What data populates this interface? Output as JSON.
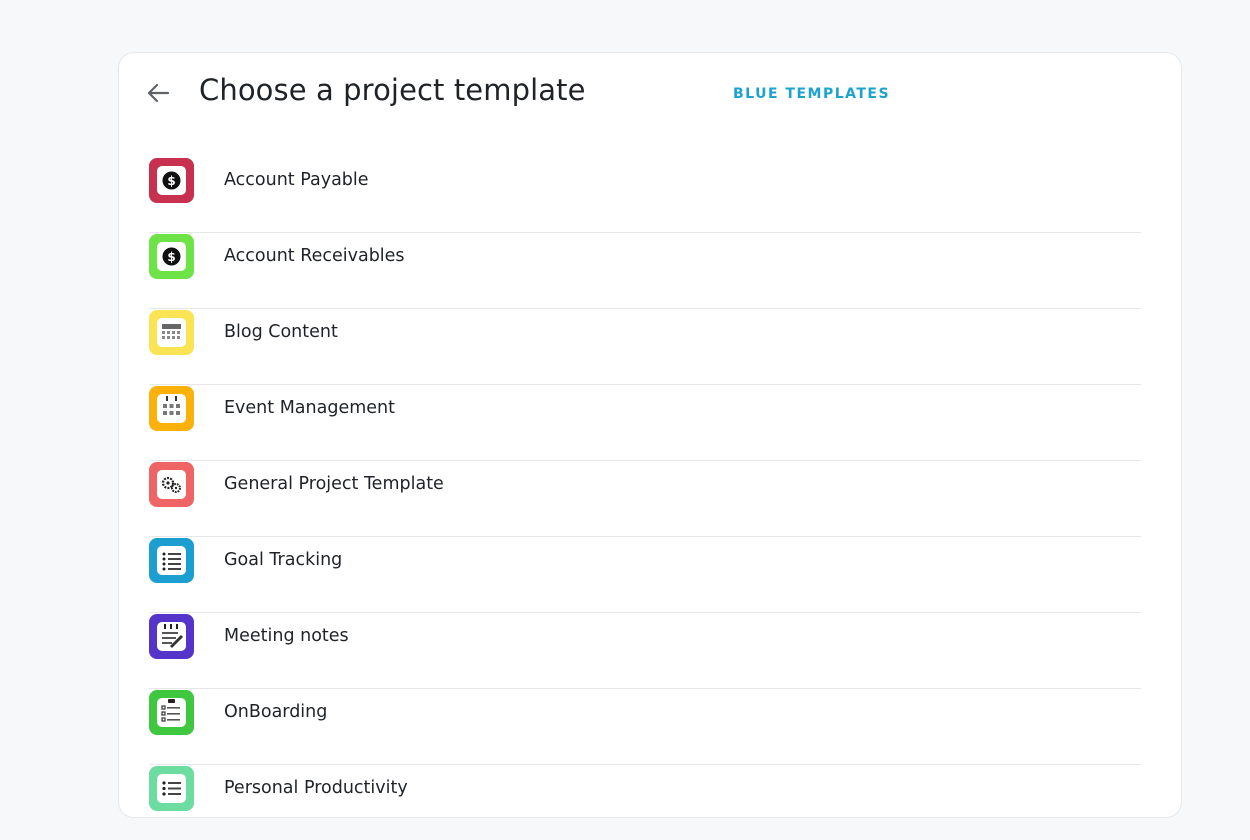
{
  "header": {
    "title": "Choose a project template",
    "blue_templates_label": "BLUE TEMPLATES",
    "accent_color": "#1aa3cf"
  },
  "templates": [
    {
      "label": "Account Payable",
      "icon": "dollar-icon",
      "color": "#c7304e"
    },
    {
      "label": "Account Receivables",
      "icon": "dollar-icon",
      "color": "#6de347"
    },
    {
      "label": "Blog Content",
      "icon": "calendar-icon",
      "color": "#fbe454"
    },
    {
      "label": "Event Management",
      "icon": "calendar-icon",
      "color": "#fbb10c"
    },
    {
      "label": "General Project Template",
      "icon": "gears-icon",
      "color": "#ef6565"
    },
    {
      "label": "Goal Tracking",
      "icon": "checklist-icon",
      "color": "#1c9fd0"
    },
    {
      "label": "Meeting notes",
      "icon": "notepad-icon",
      "color": "#5534c9"
    },
    {
      "label": "OnBoarding",
      "icon": "clipboard-icon",
      "color": "#3fc73f"
    },
    {
      "label": "Personal Productivity",
      "icon": "list-icon",
      "color": "#6ddca1"
    }
  ]
}
